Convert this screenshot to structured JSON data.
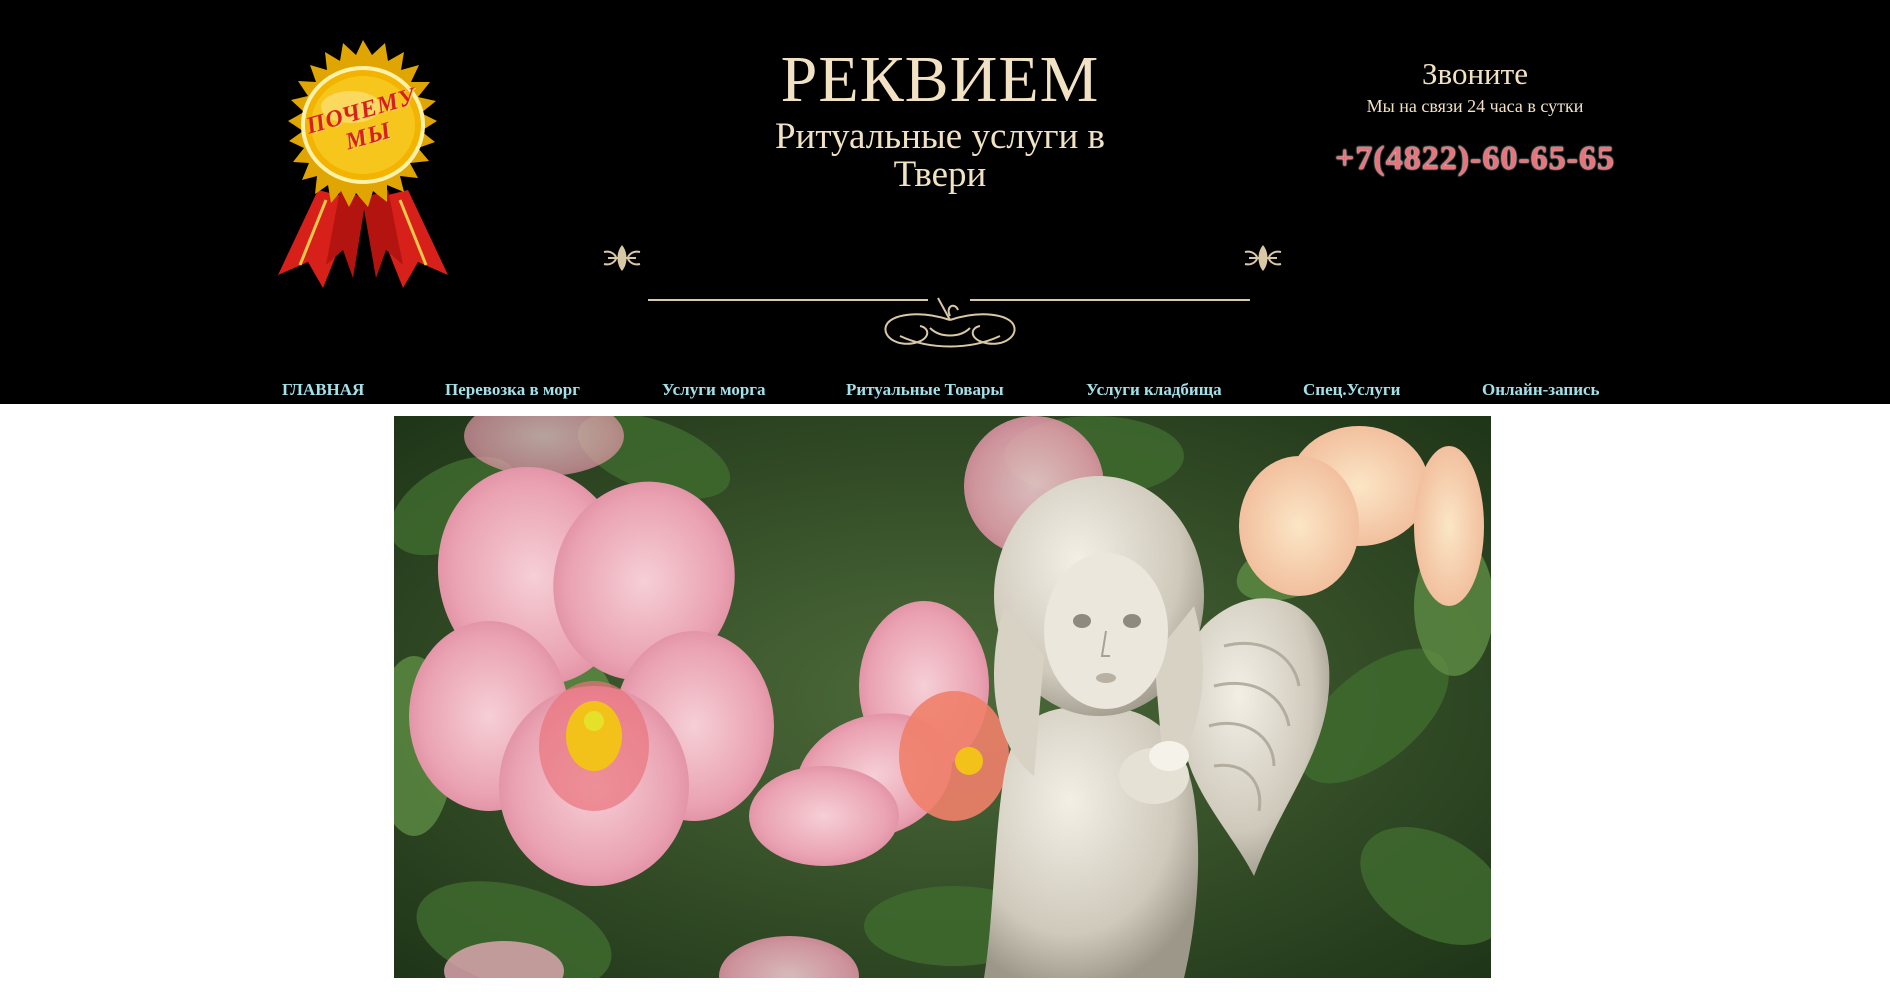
{
  "medal": {
    "text": "Почему мы",
    "colors": {
      "gold": "#f2b400",
      "ribbon": "#d8201a"
    }
  },
  "brand": {
    "title": "РЕКВИЕМ",
    "subtitle": "Ритуальные услуги в Твери"
  },
  "contact": {
    "call_label": "Звоните",
    "hours": "Мы на связи 24 часа в сутки",
    "phone": "+7(4822)-60-65-65"
  },
  "nav": {
    "items": [
      {
        "label": "ГЛАВНАЯ"
      },
      {
        "label": "Перевозка в морг"
      },
      {
        "label": "Услуги морга"
      },
      {
        "label": "Ритуальные Товары"
      },
      {
        "label": "Услуги кладбища"
      },
      {
        "label": "Спец.Услуги"
      },
      {
        "label": "Онлайн-запись"
      }
    ]
  },
  "colors": {
    "header_bg": "#000000",
    "brand_text": "#f2e2c4",
    "nav_text": "#a4e0e8",
    "phone_text": "#e8737a"
  },
  "hero": {
    "icon": "angel-statue-with-pansies-image"
  }
}
